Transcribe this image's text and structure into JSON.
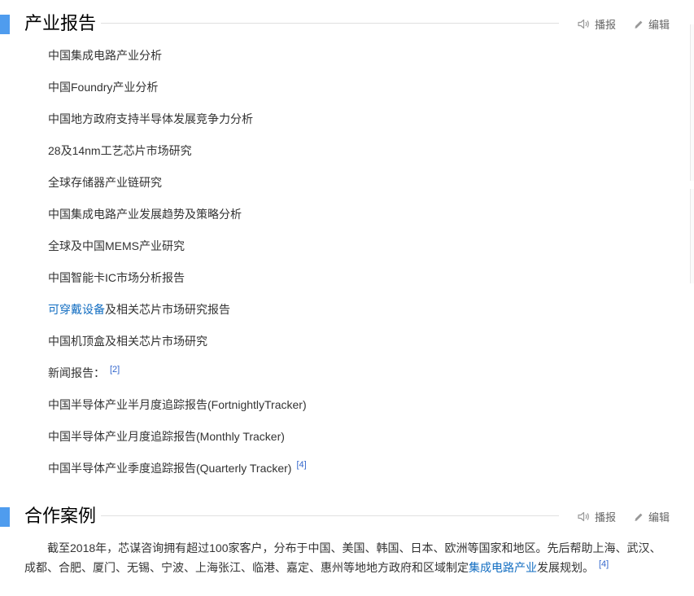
{
  "toolbar": {
    "listen_label": "播报",
    "edit_label": "编辑"
  },
  "reports_section": {
    "title": "产业报告",
    "items": [
      {
        "text": "中国集成电路产业分析"
      },
      {
        "text": "中国Foundry产业分析"
      },
      {
        "text": "中国地方政府支持半导体发展竞争力分析"
      },
      {
        "text": "28及14nm工艺芯片市场研究"
      },
      {
        "text": "全球存储器产业链研究"
      },
      {
        "text": "中国集成电路产业发展趋势及策略分析"
      },
      {
        "text": "全球及中国MEMS产业研究"
      },
      {
        "text": "中国智能卡IC市场分析报告"
      },
      {
        "link": "可穿戴设备",
        "text": "及相关芯片市场研究报告"
      },
      {
        "text": "中国机顶盒及相关芯片市场研究"
      },
      {
        "text": "新闻报告：",
        "ref": "[2]"
      },
      {
        "text": "中国半导体产业半月度追踪报告(FortnightlyTracker)"
      },
      {
        "text": "中国半导体产业月度追踪报告(Monthly Tracker)"
      },
      {
        "text": "中国半导体产业季度追踪报告(Quarterly Tracker)",
        "ref": "[4]"
      }
    ]
  },
  "cases_section": {
    "title": "合作案例",
    "paragraph": {
      "before": "截至2018年，芯谋咨询拥有超过100家客户，分布于中国、美国、韩国、日本、欧洲等国家和地区。先后帮助上海、武汉、成都、合肥、厦门、无锡、宁波、上海张江、临港、嘉定、惠州等地地方政府和区域制定",
      "link": "集成电路产业",
      "after": "发展规划。",
      "ref": "[4]"
    }
  },
  "icons": {
    "listen": "speaker-icon",
    "edit": "pencil-icon"
  },
  "colors": {
    "accent_bar": "#4f9cee",
    "link": "#136ec2",
    "ref": "#3366cc"
  }
}
